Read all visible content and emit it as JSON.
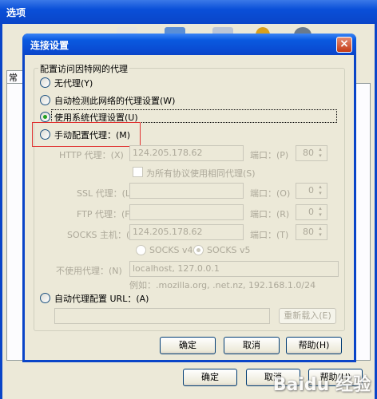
{
  "outer": {
    "title": "选项",
    "tab_label": "常规",
    "buttons": {
      "ok": "确定",
      "cancel": "取消",
      "help": "帮助(H)"
    }
  },
  "dialog": {
    "title": "连接设置",
    "group_label": "配置访问因特网的代理",
    "radio_none": "无代理(Y)",
    "radio_auto_detect": "自动检测此网络的代理设置(W)",
    "radio_system": "使用系统代理设置(U)",
    "radio_manual": "手动配置代理：(M)",
    "http_label": "HTTP 代理：(X)",
    "http_value": "124.205.178.62",
    "port_label_http": "端口：(P)",
    "http_port": "80",
    "same_proxy_label": "为所有协议使用相同代理(S)",
    "ssl_label": "SSL 代理：(L)",
    "ssl_value": "",
    "port_label_ssl": "端口：(O)",
    "ssl_port": "0",
    "ftp_label": "FTP 代理：(F)",
    "ftp_value": "",
    "port_label_ftp": "端口：(R)",
    "ftp_port": "0",
    "socks_label": "SOCKS 主机：(C)",
    "socks_value": "124.205.178.62",
    "port_label_socks": "端口：(T)",
    "socks_port": "80",
    "socks_v4": "SOCKS v4",
    "socks_v5": "SOCKS v5",
    "no_proxy_label": "不使用代理：(N)",
    "no_proxy_value": "localhost, 127.0.0.1",
    "example_text": "例如：.mozilla.org, .net.nz, 192.168.1.0/24",
    "radio_pac": "自动代理配置 URL：(A)",
    "pac_value": "",
    "reload_button": "重新载入(E)",
    "ok_button": "确定",
    "cancel_button": "取消",
    "help_button": "帮助(H)"
  },
  "watermark": "Baidu 经验",
  "colors": {
    "titlebar": "#0a45c8",
    "dialog_bg": "#ece9d8",
    "highlight_box": "#e03030"
  },
  "selected_option": "radio_system"
}
